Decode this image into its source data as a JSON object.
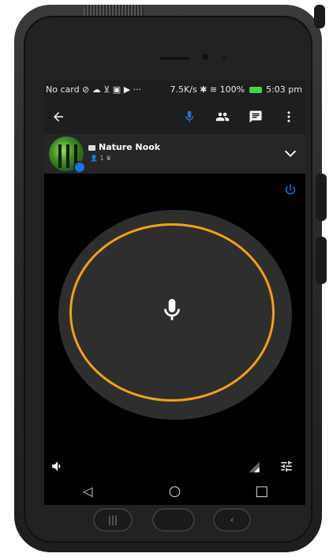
{
  "status_bar": {
    "left_text": "No card ⊘ ☁ ⊻ ▣ ▶ ···",
    "speed": "7.5K/s",
    "battery_percent": "100%",
    "time": "5:03 pm"
  },
  "app_bar": {
    "back_icon": "arrow-back-icon",
    "mic_icon": "mic-icon",
    "people_icon": "people-icon",
    "chat_icon": "chat-icon",
    "more_icon": "more-vert-icon",
    "accent_color": "#1a73e8"
  },
  "room": {
    "title": "Nature Nook",
    "members_count": "1",
    "expand_icon": "chevron-down-icon"
  },
  "voice": {
    "ring_color": "#f3a116",
    "power_icon": "power-icon",
    "center_icon": "mic-icon"
  },
  "controls": {
    "speaker_icon": "volume-icon",
    "signal_icon": "signal-icon",
    "settings_icon": "tune-icon"
  },
  "navigation": {
    "back": "◁",
    "home": "○",
    "recents": "□"
  },
  "hardware_keys": {
    "left": "|||",
    "right": "‹"
  }
}
